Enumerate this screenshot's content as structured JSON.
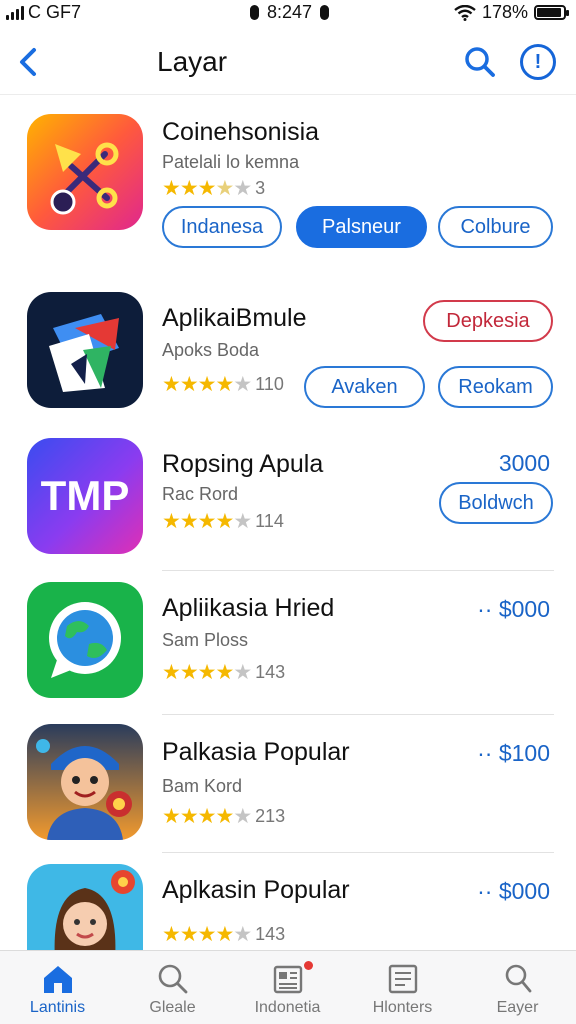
{
  "status_bar": {
    "carrier": "C GF7",
    "time": "8:247",
    "battery": "178%"
  },
  "nav": {
    "title": "Layar"
  },
  "apps": [
    {
      "name": "Coinehsonisia",
      "subtitle": "Patelali lo kemna",
      "rating_count": "3",
      "rating": 3.5,
      "buttons": [
        "Indanesa",
        "Palsneur",
        "Colbure"
      ]
    },
    {
      "name": "AplikaiBmule",
      "subtitle": "Apoks Boda",
      "rating_count": "110",
      "rating": 4,
      "action": "Depkesia",
      "buttons": [
        "Avaken",
        "Reokam"
      ]
    },
    {
      "name": "Ropsing Apula",
      "subtitle": "Rac Rord",
      "rating_count": "114",
      "rating": 4,
      "price": "3000",
      "buttons": [
        "Boldwch"
      ]
    },
    {
      "name": "Apliikasia Hried",
      "subtitle": "Sam Ploss",
      "rating_count": "143",
      "rating": 4,
      "price": "·· $000"
    },
    {
      "name": "Palkasia Popular",
      "subtitle": "Bam Kord",
      "rating_count": "213",
      "rating": 4,
      "price": "·· $100"
    },
    {
      "name": "Aplkasin Popular",
      "rating_count": "143",
      "rating": 4,
      "price": "·· $000"
    }
  ],
  "tabs": [
    {
      "label": "Lantinis",
      "icon": "home-icon",
      "active": true
    },
    {
      "label": "Gleale",
      "icon": "search-icon"
    },
    {
      "label": "Indonetia",
      "icon": "news-icon",
      "badge": true
    },
    {
      "label": "Hlonters",
      "icon": "document-icon"
    },
    {
      "label": "Eayer",
      "icon": "profile-icon"
    }
  ],
  "colors": {
    "accent": "#1a6de0",
    "danger": "#c2283a",
    "star": "#f5b800"
  }
}
